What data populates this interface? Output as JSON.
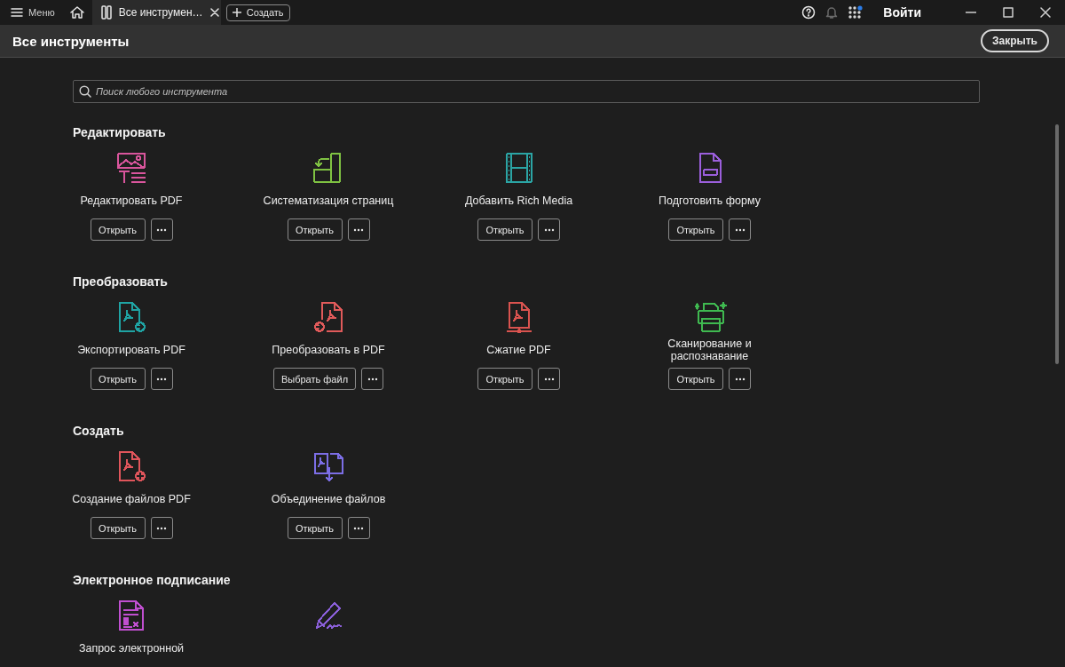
{
  "titlebar": {
    "menu_label": "Меню",
    "tabs": [
      {
        "label": "Все инструмен…",
        "selected": true
      }
    ],
    "create_button": "Создать",
    "sign_in": "Войти"
  },
  "header": {
    "title": "Все инструменты",
    "close_button": "Закрыть"
  },
  "search": {
    "placeholder": "Поиск любого инструмента"
  },
  "sections": [
    {
      "title": "Редактировать",
      "tools": [
        {
          "label": "Редактировать PDF",
          "kind": "image-text",
          "color": "#d9559c",
          "action": "Открыть"
        },
        {
          "label": "Систематизация страниц",
          "kind": "pages",
          "color": "#7fc242",
          "action": "Открыть"
        },
        {
          "label": "Добавить Rich Media",
          "kind": "film",
          "color": "#2ba5a5",
          "action": "Открыть"
        },
        {
          "label": "Подготовить форму",
          "kind": "form",
          "color": "#9b5fdc",
          "action": "Открыть"
        }
      ]
    },
    {
      "title": "Преобразовать",
      "tools": [
        {
          "label": "Экспортировать PDF",
          "kind": "pdf-out",
          "color": "#1fa3a3",
          "action": "Открыть"
        },
        {
          "label": "Преобразовать в PDF",
          "kind": "pdf-in",
          "color": "#e05a5a",
          "action": "Выбрать файл"
        },
        {
          "label": "Сжатие PDF",
          "kind": "pdf-compress",
          "color": "#d9534f",
          "action": "Открыть"
        },
        {
          "label": "Сканирование и распознавание",
          "kind": "scanner",
          "color": "#3fb950",
          "action": "Открыть"
        }
      ]
    },
    {
      "title": "Создать",
      "tools": [
        {
          "label": "Создание файлов PDF",
          "kind": "pdf-plus",
          "color": "#e0555b",
          "action": "Открыть"
        },
        {
          "label": "Объединение файлов",
          "kind": "combine",
          "color": "#7c6ee6",
          "action": "Открыть"
        }
      ]
    },
    {
      "title": "Электронное подписание",
      "tools": [
        {
          "label": "Запрос электронной",
          "kind": "sign-doc",
          "color": "#c04fd0"
        },
        {
          "kind": "pen",
          "color": "#8a5fd8"
        }
      ]
    }
  ]
}
